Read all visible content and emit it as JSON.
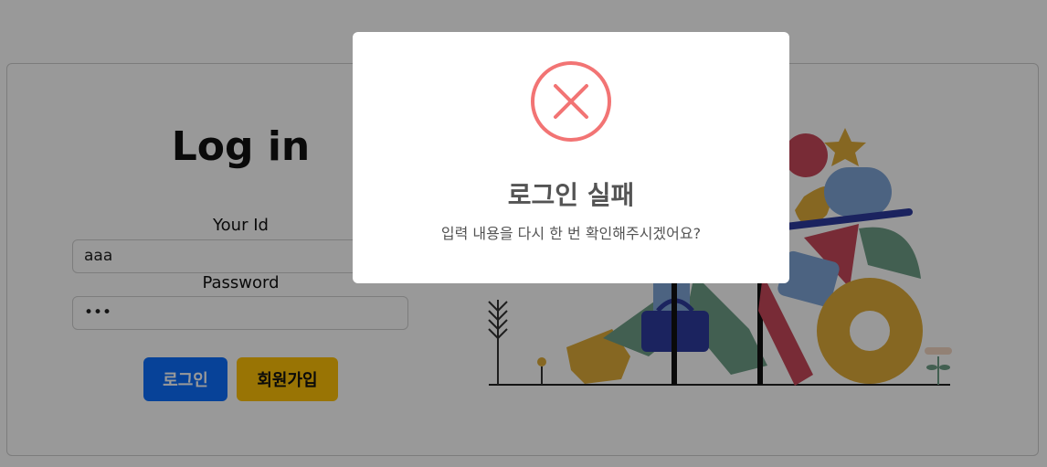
{
  "login": {
    "title": "Log in",
    "id_label": "Your Id",
    "id_value": "aaa",
    "password_label": "Password",
    "password_value": "•••",
    "login_button": "로그인",
    "signup_button": "회원가입"
  },
  "modal": {
    "icon": "error-x-icon",
    "title": "로그인 실패",
    "message": "입력 내용을 다시 한 번 확인해주시겠어요?"
  },
  "colors": {
    "primary": "#0d6efd",
    "warning": "#ffc107",
    "error": "#f27474",
    "overlay": "rgba(0,0,0,0.4)"
  }
}
